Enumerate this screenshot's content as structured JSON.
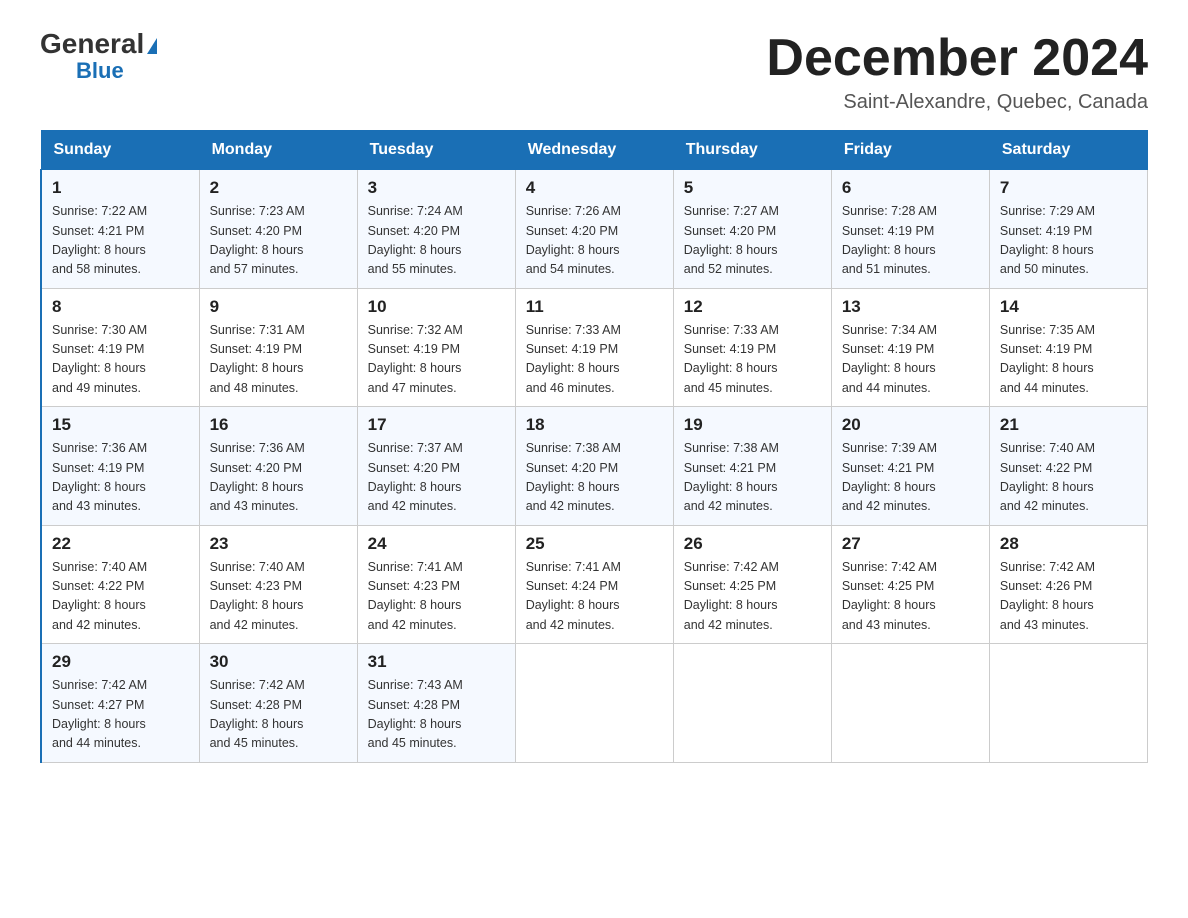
{
  "header": {
    "logo_general": "General",
    "logo_blue": "Blue",
    "month_title": "December 2024",
    "location": "Saint-Alexandre, Quebec, Canada"
  },
  "days_of_week": [
    "Sunday",
    "Monday",
    "Tuesday",
    "Wednesday",
    "Thursday",
    "Friday",
    "Saturday"
  ],
  "weeks": [
    [
      {
        "day": "1",
        "sunrise": "7:22 AM",
        "sunset": "4:21 PM",
        "daylight": "8 hours and 58 minutes."
      },
      {
        "day": "2",
        "sunrise": "7:23 AM",
        "sunset": "4:20 PM",
        "daylight": "8 hours and 57 minutes."
      },
      {
        "day": "3",
        "sunrise": "7:24 AM",
        "sunset": "4:20 PM",
        "daylight": "8 hours and 55 minutes."
      },
      {
        "day": "4",
        "sunrise": "7:26 AM",
        "sunset": "4:20 PM",
        "daylight": "8 hours and 54 minutes."
      },
      {
        "day": "5",
        "sunrise": "7:27 AM",
        "sunset": "4:20 PM",
        "daylight": "8 hours and 52 minutes."
      },
      {
        "day": "6",
        "sunrise": "7:28 AM",
        "sunset": "4:19 PM",
        "daylight": "8 hours and 51 minutes."
      },
      {
        "day": "7",
        "sunrise": "7:29 AM",
        "sunset": "4:19 PM",
        "daylight": "8 hours and 50 minutes."
      }
    ],
    [
      {
        "day": "8",
        "sunrise": "7:30 AM",
        "sunset": "4:19 PM",
        "daylight": "8 hours and 49 minutes."
      },
      {
        "day": "9",
        "sunrise": "7:31 AM",
        "sunset": "4:19 PM",
        "daylight": "8 hours and 48 minutes."
      },
      {
        "day": "10",
        "sunrise": "7:32 AM",
        "sunset": "4:19 PM",
        "daylight": "8 hours and 47 minutes."
      },
      {
        "day": "11",
        "sunrise": "7:33 AM",
        "sunset": "4:19 PM",
        "daylight": "8 hours and 46 minutes."
      },
      {
        "day": "12",
        "sunrise": "7:33 AM",
        "sunset": "4:19 PM",
        "daylight": "8 hours and 45 minutes."
      },
      {
        "day": "13",
        "sunrise": "7:34 AM",
        "sunset": "4:19 PM",
        "daylight": "8 hours and 44 minutes."
      },
      {
        "day": "14",
        "sunrise": "7:35 AM",
        "sunset": "4:19 PM",
        "daylight": "8 hours and 44 minutes."
      }
    ],
    [
      {
        "day": "15",
        "sunrise": "7:36 AM",
        "sunset": "4:19 PM",
        "daylight": "8 hours and 43 minutes."
      },
      {
        "day": "16",
        "sunrise": "7:36 AM",
        "sunset": "4:20 PM",
        "daylight": "8 hours and 43 minutes."
      },
      {
        "day": "17",
        "sunrise": "7:37 AM",
        "sunset": "4:20 PM",
        "daylight": "8 hours and 42 minutes."
      },
      {
        "day": "18",
        "sunrise": "7:38 AM",
        "sunset": "4:20 PM",
        "daylight": "8 hours and 42 minutes."
      },
      {
        "day": "19",
        "sunrise": "7:38 AM",
        "sunset": "4:21 PM",
        "daylight": "8 hours and 42 minutes."
      },
      {
        "day": "20",
        "sunrise": "7:39 AM",
        "sunset": "4:21 PM",
        "daylight": "8 hours and 42 minutes."
      },
      {
        "day": "21",
        "sunrise": "7:40 AM",
        "sunset": "4:22 PM",
        "daylight": "8 hours and 42 minutes."
      }
    ],
    [
      {
        "day": "22",
        "sunrise": "7:40 AM",
        "sunset": "4:22 PM",
        "daylight": "8 hours and 42 minutes."
      },
      {
        "day": "23",
        "sunrise": "7:40 AM",
        "sunset": "4:23 PM",
        "daylight": "8 hours and 42 minutes."
      },
      {
        "day": "24",
        "sunrise": "7:41 AM",
        "sunset": "4:23 PM",
        "daylight": "8 hours and 42 minutes."
      },
      {
        "day": "25",
        "sunrise": "7:41 AM",
        "sunset": "4:24 PM",
        "daylight": "8 hours and 42 minutes."
      },
      {
        "day": "26",
        "sunrise": "7:42 AM",
        "sunset": "4:25 PM",
        "daylight": "8 hours and 42 minutes."
      },
      {
        "day": "27",
        "sunrise": "7:42 AM",
        "sunset": "4:25 PM",
        "daylight": "8 hours and 43 minutes."
      },
      {
        "day": "28",
        "sunrise": "7:42 AM",
        "sunset": "4:26 PM",
        "daylight": "8 hours and 43 minutes."
      }
    ],
    [
      {
        "day": "29",
        "sunrise": "7:42 AM",
        "sunset": "4:27 PM",
        "daylight": "8 hours and 44 minutes."
      },
      {
        "day": "30",
        "sunrise": "7:42 AM",
        "sunset": "4:28 PM",
        "daylight": "8 hours and 45 minutes."
      },
      {
        "day": "31",
        "sunrise": "7:43 AM",
        "sunset": "4:28 PM",
        "daylight": "8 hours and 45 minutes."
      },
      null,
      null,
      null,
      null
    ]
  ],
  "labels": {
    "sunrise": "Sunrise:",
    "sunset": "Sunset:",
    "daylight": "Daylight:"
  }
}
